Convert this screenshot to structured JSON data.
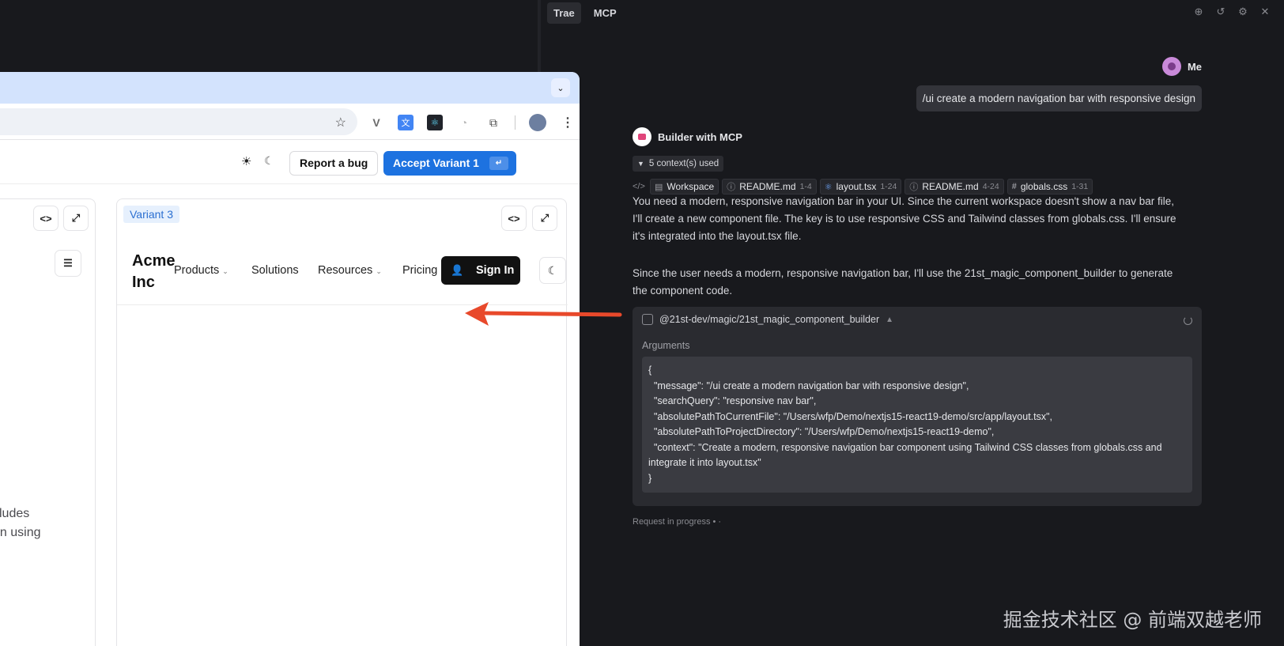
{
  "chat": {
    "tabs": [
      "Trae",
      "MCP"
    ],
    "me_name": "Me",
    "user_message": "/ui create a modern navigation bar with responsive design",
    "builder_name": "Builder with MCP",
    "contexts_used": "5 context(s) used",
    "chips": [
      {
        "label": "Workspace",
        "range": ""
      },
      {
        "label": "README.md",
        "range": "1-4"
      },
      {
        "label": "layout.tsx",
        "range": "1-24"
      },
      {
        "label": "README.md",
        "range": "4-24"
      },
      {
        "label": "globals.css",
        "range": "1-31"
      }
    ],
    "para1": "You need a modern, responsive navigation bar in your UI. Since the current workspace doesn't show a nav bar file, I'll create a new component file. The key is to use responsive CSS and Tailwind classes from globals.css. I'll ensure it's integrated into the layout.tsx file.",
    "para2": "Since the user needs a modern, responsive navigation bar, I'll use the 21st_magic_component_builder to generate the component code.",
    "tool_name": "@21st-dev/magic/21st_magic_component_builder",
    "args_label": "Arguments",
    "args_code": "{\n  \"message\": \"/ui create a modern navigation bar with responsive design\",\n  \"searchQuery\": \"responsive nav bar\",\n  \"absolutePathToCurrentFile\": \"/Users/wfp/Demo/nextjs15-react19-demo/src/app/layout.tsx\",\n  \"absolutePathToProjectDirectory\": \"/Users/wfp/Demo/nextjs15-react19-demo\",\n  \"context\": \"Create a modern, responsive navigation bar component using Tailwind CSS classes from globals.css and integrate it into layout.tsx\"\n}",
    "request_status": "Request in progress • ·",
    "watermark": "掘金技术社区 @ 前端双越老师"
  },
  "browser": {
    "report_bug": "Report a bug",
    "accept_variant": "Accept Variant 1",
    "accept_kbd": "↵",
    "left_text_line1": "cludes",
    "left_text_line2": "gn using",
    "variant_badge": "Variant 3",
    "brand": "Acme Inc",
    "nav": [
      "Products",
      "Solutions",
      "Resources",
      "Pricing"
    ],
    "sign_in": "Sign In"
  },
  "colors": {
    "accent": "#1d72e0",
    "arrow": "#e8492b",
    "chat_bg": "#18191d"
  }
}
